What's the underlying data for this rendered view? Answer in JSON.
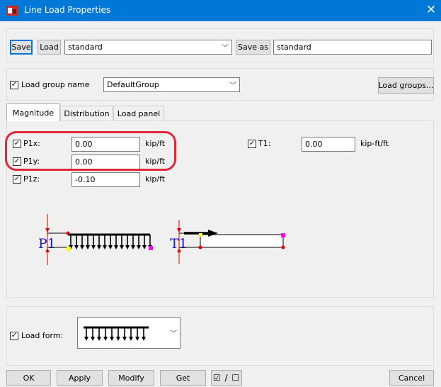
{
  "window": {
    "title": "Line Load Properties",
    "close_glyph": "✕",
    "icon": "app-icon"
  },
  "toolbar": {
    "save_label": "Save",
    "load_label": "Load",
    "preset_value": "standard",
    "save_as_label": "Save as",
    "save_as_value": "standard"
  },
  "load_group": {
    "checked": true,
    "label": "Load group name",
    "value": "DefaultGroup",
    "button_label": "Load groups..."
  },
  "tabs": [
    {
      "label": "Magnitude",
      "active": true
    },
    {
      "label": "Distribution",
      "active": false
    },
    {
      "label": "Load panel",
      "active": false
    }
  ],
  "magnitude": {
    "p1x": {
      "label": "P1x:",
      "value": "0.00",
      "unit": "kip/ft",
      "checked": true
    },
    "p1y": {
      "label": "P1y:",
      "value": "0.00",
      "unit": "kip/ft",
      "checked": true
    },
    "p1z": {
      "label": "P1z:",
      "value": "-0.10",
      "unit": "kip/ft",
      "checked": true
    },
    "t1": {
      "label": "T1:",
      "value": "0.00",
      "unit": "kip-ft/ft",
      "checked": true
    }
  },
  "diagram": {
    "p1_label": "P1",
    "t1_label": "T1"
  },
  "load_form": {
    "checked": true,
    "label": "Load form:"
  },
  "footer": {
    "ok_label": "OK",
    "apply_label": "Apply",
    "modify_label": "Modify",
    "get_label": "Get",
    "toggle_label": "☑ / ☐",
    "cancel_label": "Cancel"
  },
  "colors": {
    "titlebar": "#0078d7",
    "highlight_ring": "#e02838",
    "diagram_text": "#1a1ad0",
    "marker_magenta": "#ff00ff",
    "marker_yellow": "#ffff00",
    "marker_red": "#e00000"
  }
}
